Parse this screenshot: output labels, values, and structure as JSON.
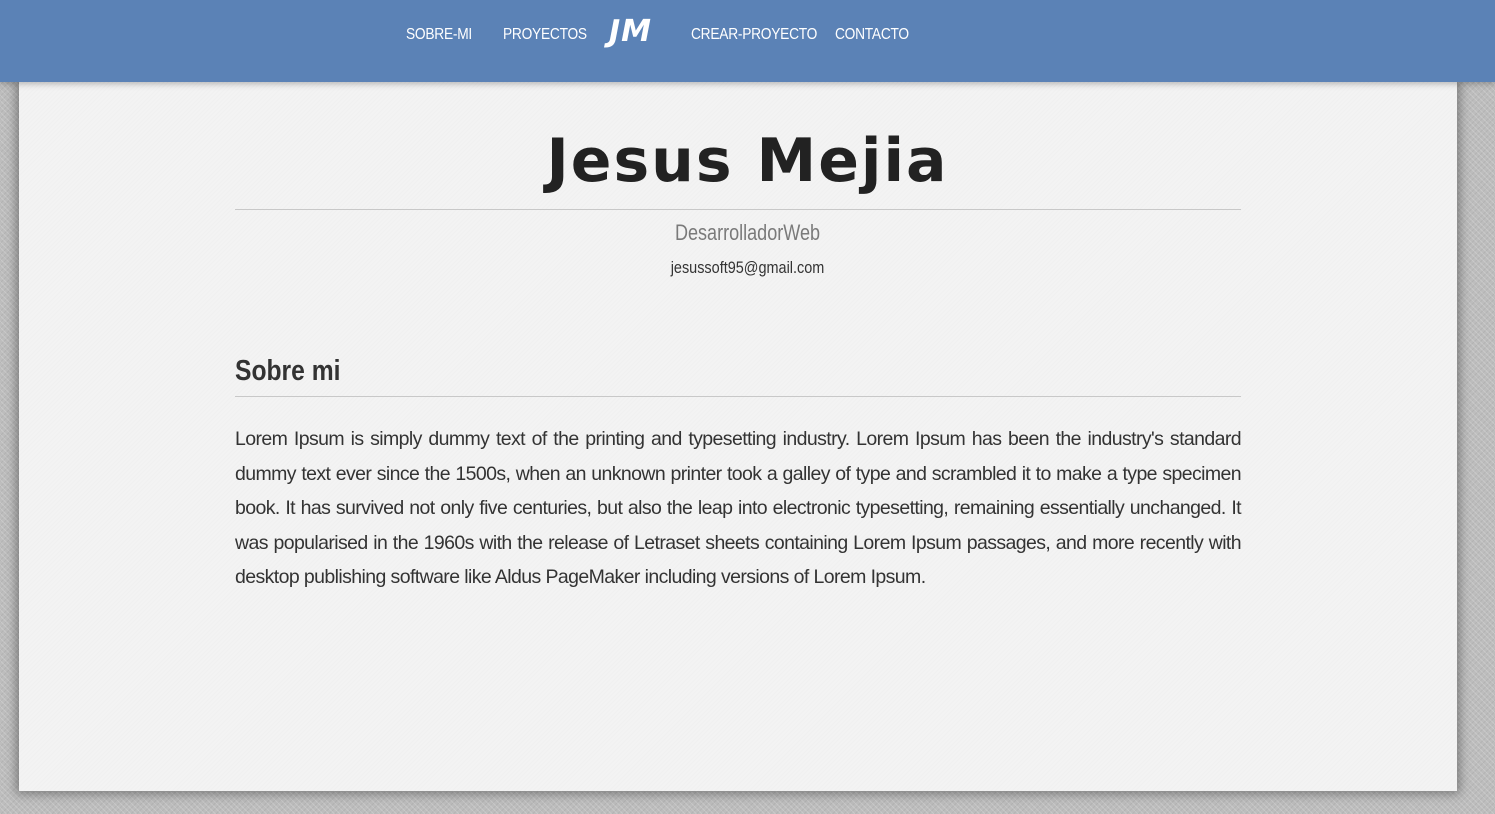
{
  "nav": {
    "items": [
      {
        "label": "SOBRE-MI"
      },
      {
        "label": "PROYECTOS"
      },
      {
        "label": "CREAR-PROYECTO"
      },
      {
        "label": "CONTACTO"
      }
    ],
    "logo": "JM"
  },
  "hero": {
    "name": "Jesus Mejia",
    "role": "DesarrolladorWeb",
    "email": "jesussoft95@gmail.com"
  },
  "about": {
    "title": "Sobre mi",
    "text": "Lorem Ipsum is simply dummy text of the printing and typesetting industry. Lorem Ipsum has been the industry's standard dummy text ever since the 1500s, when an unknown printer took a galley of type and scrambled it to make a type specimen book. It has survived not only five centuries, but also the leap into electronic typesetting, remaining essentially unchanged. It was popularised in the 1960s with the release of Letraset sheets containing Lorem Ipsum passages, and more recently with desktop publishing software like Aldus PageMaker including versions of Lorem Ipsum."
  },
  "colors": {
    "nav_background": "#5b82b6",
    "card_background": "#f3f3f3",
    "page_background": "#bdbdbd"
  }
}
